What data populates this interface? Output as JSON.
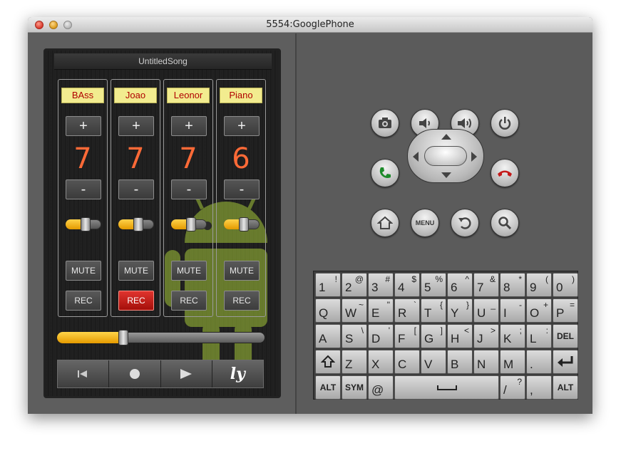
{
  "window": {
    "title": "5554:GooglePhone"
  },
  "app": {
    "title": "UntitledSong",
    "tracks": [
      {
        "name": "BAss",
        "volume": "7",
        "level": 0.55,
        "mute": "MUTE",
        "rec": "REC",
        "rec_active": false
      },
      {
        "name": "Joao",
        "volume": "7",
        "level": 0.55,
        "mute": "MUTE",
        "rec": "REC",
        "rec_active": true
      },
      {
        "name": "Leonor",
        "volume": "7",
        "level": 0.55,
        "mute": "MUTE",
        "rec": "REC",
        "rec_active": false
      },
      {
        "name": "Piano",
        "volume": "6",
        "level": 0.55,
        "mute": "MUTE",
        "rec": "REC",
        "rec_active": false
      }
    ],
    "plus_label": "+",
    "minus_label": "-",
    "master_level": 0.32,
    "transport": {
      "logo": "ly"
    }
  },
  "hardware": {
    "menu_label": "MENU"
  },
  "keyboard": {
    "rows": [
      [
        {
          "m": "1",
          "s": "!"
        },
        {
          "m": "2",
          "s": "@"
        },
        {
          "m": "3",
          "s": "#"
        },
        {
          "m": "4",
          "s": "$"
        },
        {
          "m": "5",
          "s": "%"
        },
        {
          "m": "6",
          "s": "^"
        },
        {
          "m": "7",
          "s": "&"
        },
        {
          "m": "8",
          "s": "*"
        },
        {
          "m": "9",
          "s": "("
        },
        {
          "m": "0",
          "s": ")"
        }
      ],
      [
        {
          "m": "Q",
          "s": ""
        },
        {
          "m": "W",
          "s": "~"
        },
        {
          "m": "E",
          "s": "\""
        },
        {
          "m": "R",
          "s": "`"
        },
        {
          "m": "T",
          "s": "{"
        },
        {
          "m": "Y",
          "s": "}"
        },
        {
          "m": "U",
          "s": "_"
        },
        {
          "m": "I",
          "s": "-"
        },
        {
          "m": "O",
          "s": "+"
        },
        {
          "m": "P",
          "s": "="
        }
      ],
      [
        {
          "m": "A",
          "s": ""
        },
        {
          "m": "S",
          "s": "\\"
        },
        {
          "m": "D",
          "s": "'"
        },
        {
          "m": "F",
          "s": "["
        },
        {
          "m": "G",
          "s": "]"
        },
        {
          "m": "H",
          "s": "<"
        },
        {
          "m": "J",
          "s": ">"
        },
        {
          "m": "K",
          "s": ";"
        },
        {
          "m": "L",
          "s": ":"
        },
        {
          "c": "DEL"
        }
      ],
      [
        {
          "icon": "shift-icon"
        },
        {
          "m": "Z",
          "s": ""
        },
        {
          "m": "X",
          "s": ""
        },
        {
          "m": "C",
          "s": ""
        },
        {
          "m": "V",
          "s": ""
        },
        {
          "m": "B",
          "s": ""
        },
        {
          "m": "N",
          "s": ""
        },
        {
          "m": "M",
          "s": ""
        },
        {
          "m": ".",
          "s": ""
        },
        {
          "icon": "enter-icon"
        }
      ],
      [
        {
          "c": "ALT"
        },
        {
          "c": "SYM"
        },
        {
          "m": "@",
          "s": ""
        },
        {
          "icon": "space-icon"
        },
        {
          "m": "/",
          "s": "?"
        },
        {
          "m": ",",
          "s": ""
        },
        {
          "c": "ALT"
        }
      ]
    ]
  }
}
